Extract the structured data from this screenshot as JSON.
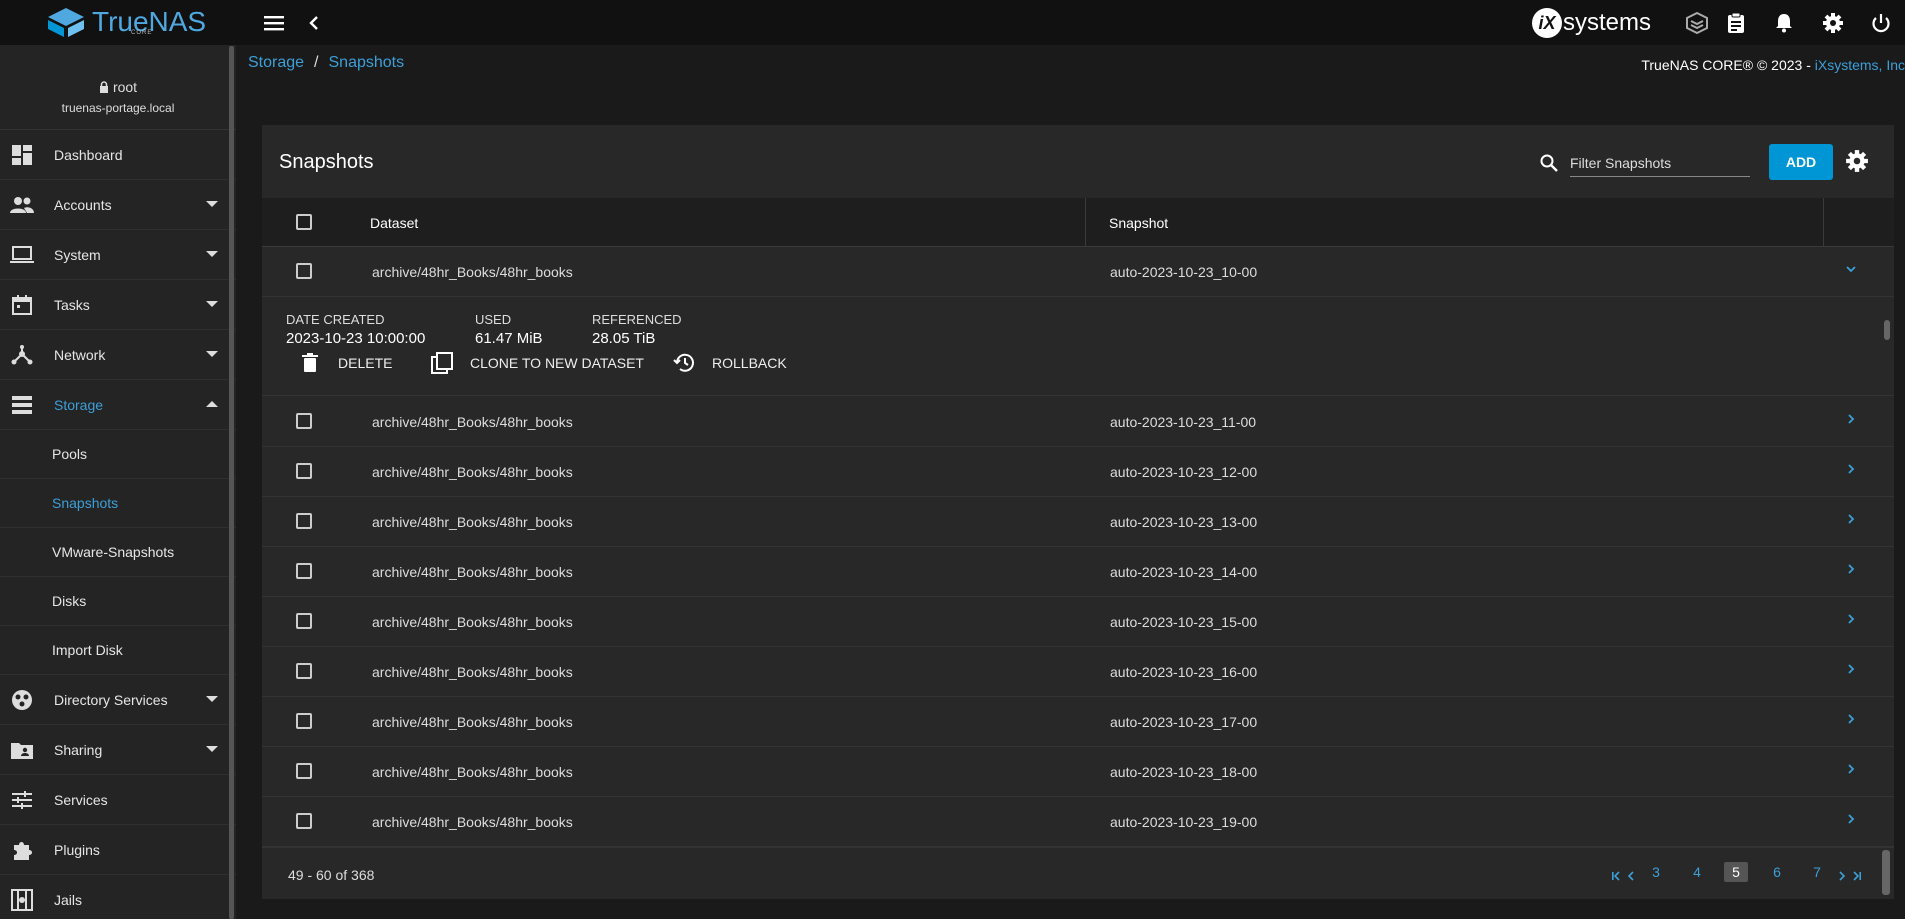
{
  "app": {
    "brand": "TrueNAS",
    "brand_sub": "CORE",
    "vendor": "systems",
    "vendor_badge": "iX"
  },
  "user": {
    "name": "root",
    "host": "truenas-portage.local"
  },
  "sidebar": {
    "items": [
      {
        "label": "Dashboard",
        "icon": "dashboard-icon"
      },
      {
        "label": "Accounts",
        "icon": "accounts-icon"
      },
      {
        "label": "System",
        "icon": "laptop-icon"
      },
      {
        "label": "Tasks",
        "icon": "calendar-icon"
      },
      {
        "label": "Network",
        "icon": "network-icon"
      },
      {
        "label": "Storage",
        "icon": "storage-icon"
      },
      {
        "label": "Directory Services",
        "icon": "directory-icon"
      },
      {
        "label": "Sharing",
        "icon": "folder-share-icon"
      },
      {
        "label": "Services",
        "icon": "tune-icon"
      },
      {
        "label": "Plugins",
        "icon": "puzzle-icon"
      },
      {
        "label": "Jails",
        "icon": "jail-icon"
      }
    ],
    "storage_sub": [
      "Pools",
      "Snapshots",
      "VMware-Snapshots",
      "Disks",
      "Import Disk"
    ]
  },
  "breadcrumb": {
    "parent": "Storage",
    "sep": "/",
    "current": "Snapshots"
  },
  "copyright": {
    "text": "TrueNAS CORE® © 2023 - ",
    "link": "iXsystems, Inc"
  },
  "card": {
    "title": "Snapshots",
    "filter_placeholder": "Filter Snapshots",
    "add_label": "ADD"
  },
  "table": {
    "headers": [
      "Dataset",
      "Snapshot"
    ],
    "expanded": {
      "dataset": "archive/48hr_Books/48hr_books",
      "snapshot": "auto-2023-10-23_10-00",
      "date_created_label": "DATE CREATED",
      "date_created": "2023-10-23 10:00:00",
      "used_label": "USED",
      "used": "61.47 MiB",
      "referenced_label": "REFERENCED",
      "referenced": "28.05 TiB",
      "actions": [
        "DELETE",
        "CLONE TO NEW DATASET",
        "ROLLBACK"
      ]
    },
    "rows": [
      {
        "dataset": "archive/48hr_Books/48hr_books",
        "snapshot": "auto-2023-10-23_11-00"
      },
      {
        "dataset": "archive/48hr_Books/48hr_books",
        "snapshot": "auto-2023-10-23_12-00"
      },
      {
        "dataset": "archive/48hr_Books/48hr_books",
        "snapshot": "auto-2023-10-23_13-00"
      },
      {
        "dataset": "archive/48hr_Books/48hr_books",
        "snapshot": "auto-2023-10-23_14-00"
      },
      {
        "dataset": "archive/48hr_Books/48hr_books",
        "snapshot": "auto-2023-10-23_15-00"
      },
      {
        "dataset": "archive/48hr_Books/48hr_books",
        "snapshot": "auto-2023-10-23_16-00"
      },
      {
        "dataset": "archive/48hr_Books/48hr_books",
        "snapshot": "auto-2023-10-23_17-00"
      },
      {
        "dataset": "archive/48hr_Books/48hr_books",
        "snapshot": "auto-2023-10-23_18-00"
      },
      {
        "dataset": "archive/48hr_Books/48hr_books",
        "snapshot": "auto-2023-10-23_19-00"
      }
    ]
  },
  "pager": {
    "info": "49 - 60 of 368",
    "pages": [
      "3",
      "4",
      "5",
      "6",
      "7"
    ],
    "current": "5"
  },
  "colors": {
    "accent": "#3d9fd8",
    "button": "#0095d5",
    "background": "#1a1a1a"
  }
}
